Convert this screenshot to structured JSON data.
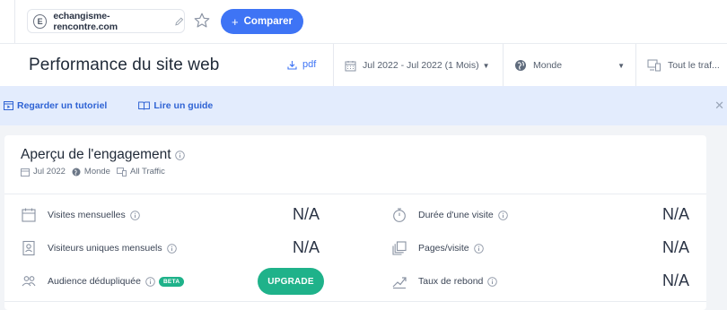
{
  "topbar": {
    "site_favicon_letter": "E",
    "site_name": "echangisme-rencontre.com",
    "compare_label": "Comparer"
  },
  "header": {
    "title": "Performance du site web",
    "pdf_label": "pdf",
    "date_filter": "Jul 2022 - Jul 2022 (1 Mois)",
    "country_filter": "Monde",
    "traffic_filter": "Tout le traf..."
  },
  "banner": {
    "tutorial_label": "Regarder un tutoriel",
    "guide_label": "Lire un guide"
  },
  "card": {
    "title": "Aperçu de l'engagement",
    "meta_date": "Jul 2022",
    "meta_country": "Monde",
    "meta_traffic": "All Traffic",
    "metrics_left": [
      {
        "label": "Visites mensuelles",
        "value": "N/A"
      },
      {
        "label": "Visiteurs uniques mensuels",
        "value": "N/A"
      },
      {
        "label": "Audience dédupliquée",
        "badge": "BETA",
        "action": "UPGRADE"
      }
    ],
    "metrics_right": [
      {
        "label": "Durée d'une visite",
        "value": "N/A"
      },
      {
        "label": "Pages/visite",
        "value": "N/A"
      },
      {
        "label": "Taux de rebond",
        "value": "N/A"
      }
    ]
  },
  "colors": {
    "accent": "#3e74f5",
    "banner_bg": "#e3ecfd",
    "upgrade": "#1fb28a"
  }
}
